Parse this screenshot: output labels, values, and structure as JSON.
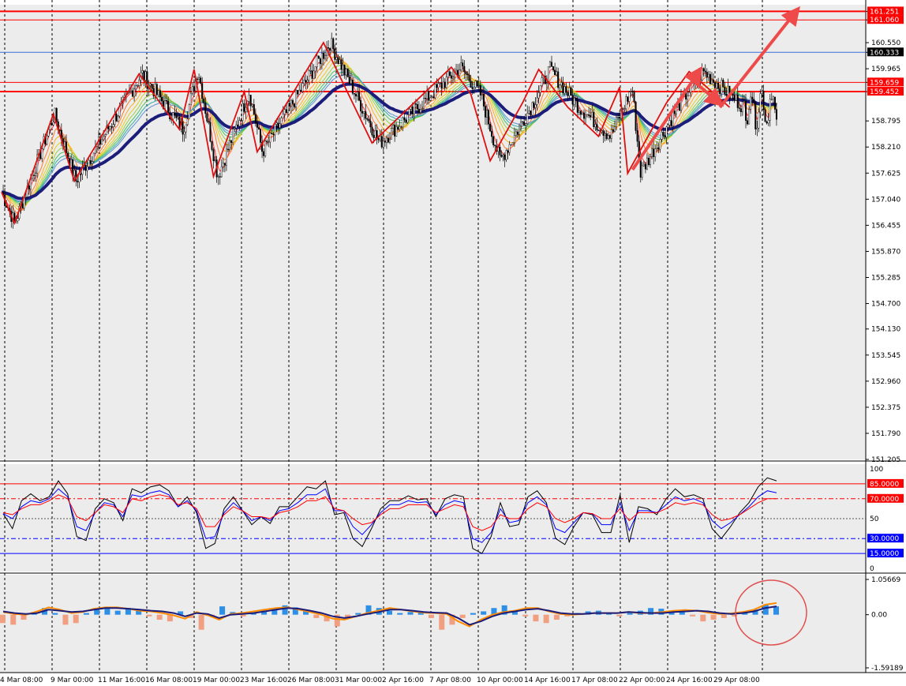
{
  "chart_data": [
    {
      "type": "candlestick",
      "ylim": [
        151.205,
        161.4
      ],
      "price_ticks": [
        "161.251",
        "161.060",
        "160.550",
        "160.333",
        "159.965",
        "159.659",
        "159.452",
        "158.795",
        "158.210",
        "157.625",
        "157.040",
        "156.455",
        "155.870",
        "155.285",
        "154.700",
        "154.130",
        "153.545",
        "152.960",
        "152.375",
        "151.790",
        "151.205"
      ],
      "tagged_levels": [
        {
          "label": "161.251",
          "value": 161.251,
          "color": "#ff0000"
        },
        {
          "label": "161.060",
          "value": 161.06,
          "color": "#ff0000"
        },
        {
          "label": "160.333",
          "value": 160.333,
          "color": "#000000"
        },
        {
          "label": "159.659",
          "value": 159.659,
          "color": "#ff0000"
        },
        {
          "label": "159.452",
          "value": 159.452,
          "color": "#ff0000"
        }
      ],
      "horizontal_lines": [
        161.251,
        161.06,
        159.659,
        159.452
      ],
      "current_price_line": 160.333,
      "zigzag": [
        {
          "bar": 0,
          "price": 157.2
        },
        {
          "bar": 8,
          "price": 156.5
        },
        {
          "bar": 32,
          "price": 158.95
        },
        {
          "bar": 45,
          "price": 157.45
        },
        {
          "bar": 85,
          "price": 159.85
        },
        {
          "bar": 110,
          "price": 158.6
        },
        {
          "bar": 119,
          "price": 159.95
        },
        {
          "bar": 131,
          "price": 157.55
        },
        {
          "bar": 150,
          "price": 159.45
        },
        {
          "bar": 158,
          "price": 158.1
        },
        {
          "bar": 199,
          "price": 160.55
        },
        {
          "bar": 229,
          "price": 158.3
        },
        {
          "bar": 278,
          "price": 160.0
        },
        {
          "bar": 290,
          "price": 159.4
        },
        {
          "bar": 302,
          "price": 157.9
        },
        {
          "bar": 322,
          "price": 159.2
        },
        {
          "bar": 332,
          "price": 159.95
        },
        {
          "bar": 350,
          "price": 159.1
        },
        {
          "bar": 369,
          "price": 158.45
        },
        {
          "bar": 382,
          "price": 159.55
        },
        {
          "bar": 387,
          "price": 157.62
        },
        {
          "bar": 411,
          "price": 159.2
        },
        {
          "bar": 425,
          "price": 159.9
        },
        {
          "bar": 450,
          "price": 159.1
        }
      ],
      "projection_arrows": [
        {
          "from_bar": 390,
          "from_price": 157.7,
          "to_bar": 430,
          "to_price": 159.85
        },
        {
          "from_bar": 424,
          "from_price": 159.8,
          "to_bar": 442,
          "to_price": 159.25
        },
        {
          "from_bar": 444,
          "from_price": 159.1,
          "to_bar": 490,
          "to_price": 161.2
        }
      ]
    },
    {
      "type": "line",
      "ylim": [
        0,
        100
      ],
      "y_ticks": [
        "100",
        "85.0000",
        "70.0000",
        "50",
        "30.0000",
        "15.0000",
        "0"
      ],
      "levels": [
        {
          "value": 85,
          "label": "85.0000",
          "color": "#ff0000"
        },
        {
          "value": 70,
          "label": "70.0000",
          "color": "#ff0000"
        },
        {
          "value": 30,
          "label": "30.0000",
          "color": "#0000ff"
        },
        {
          "value": 15,
          "label": "15.0000",
          "color": "#0000ff"
        }
      ],
      "series": [
        {
          "color": "#000000",
          "values": [
            55,
            40,
            68,
            75,
            68,
            72,
            88,
            75,
            32,
            28,
            60,
            70,
            66,
            48,
            80,
            76,
            82,
            84,
            78,
            62,
            72,
            56,
            20,
            25,
            60,
            72,
            58,
            44,
            52,
            45,
            62,
            62,
            72,
            82,
            80,
            88,
            54,
            56,
            30,
            22,
            40,
            60,
            68,
            68,
            73,
            69,
            70,
            52,
            70,
            74,
            72,
            20,
            15,
            32,
            66,
            42,
            44,
            72,
            78,
            66,
            30,
            24,
            42,
            56,
            54,
            36,
            36,
            74,
            26,
            62,
            60,
            54,
            70,
            80,
            72,
            74,
            70,
            40,
            30,
            42,
            56,
            66,
            82,
            91,
            88
          ]
        },
        {
          "color": "#0000ff",
          "values": [
            55,
            50,
            62,
            68,
            66,
            70,
            80,
            72,
            42,
            38,
            56,
            66,
            64,
            52,
            74,
            72,
            76,
            78,
            74,
            62,
            68,
            58,
            30,
            32,
            56,
            66,
            58,
            48,
            52,
            48,
            58,
            60,
            66,
            74,
            74,
            80,
            58,
            58,
            42,
            34,
            44,
            56,
            64,
            64,
            68,
            66,
            67,
            54,
            64,
            68,
            66,
            30,
            26,
            36,
            60,
            46,
            48,
            66,
            72,
            64,
            40,
            36,
            46,
            56,
            55,
            44,
            44,
            66,
            38,
            58,
            58,
            56,
            64,
            72,
            68,
            70,
            66,
            48,
            40,
            46,
            54,
            62,
            72,
            78,
            76
          ]
        },
        {
          "color": "#ff0000",
          "values": [
            56,
            54,
            60,
            64,
            64,
            68,
            74,
            70,
            52,
            48,
            56,
            64,
            62,
            56,
            70,
            68,
            72,
            74,
            72,
            64,
            66,
            60,
            42,
            42,
            54,
            62,
            58,
            52,
            52,
            50,
            56,
            58,
            62,
            68,
            68,
            72,
            60,
            58,
            50,
            44,
            46,
            54,
            60,
            60,
            64,
            64,
            64,
            56,
            60,
            64,
            62,
            42,
            38,
            42,
            54,
            50,
            50,
            60,
            66,
            62,
            50,
            46,
            50,
            56,
            55,
            50,
            50,
            60,
            48,
            56,
            56,
            56,
            60,
            66,
            64,
            66,
            64,
            54,
            48,
            50,
            54,
            60,
            66,
            70,
            70
          ]
        }
      ]
    },
    {
      "type": "bar",
      "ylim": [
        -1.59189,
        1.05669
      ],
      "y_ticks": [
        "1.05669",
        "0.00",
        "-1.59189"
      ],
      "series": [
        {
          "name": "histogram",
          "values": [
            -0.25,
            -0.3,
            -0.15,
            0.05,
            0.2,
            0.05,
            -0.3,
            -0.25,
            0.05,
            0.2,
            0.18,
            0.12,
            0.2,
            0.15,
            -0.05,
            -0.15,
            -0.2,
            0.1,
            -0.1,
            -0.45,
            -0.05,
            0.25,
            0.08,
            -0.05,
            0.05,
            0.12,
            0.2,
            0.28,
            0.22,
            0.15,
            -0.1,
            -0.2,
            -0.35,
            -0.1,
            0.05,
            0.28,
            0.2,
            0.12,
            0.05,
            0.08,
            0.1,
            -0.1,
            -0.45,
            -0.3,
            -0.1,
            0.05,
            0.1,
            0.2,
            0.28,
            0.12,
            -0.05,
            -0.2,
            -0.25,
            -0.15,
            -0.05,
            0.05,
            0.1,
            0.12,
            0.05,
            -0.05,
            0.05,
            0.12,
            0.2,
            0.18,
            0.1,
            0.08,
            -0.05,
            -0.2,
            -0.15,
            -0.1,
            -0.05,
            0.05,
            0.15,
            0.3,
            0.25
          ]
        },
        {
          "name": "signal",
          "values": [
            0.1,
            0.05,
            0.02,
            0.05,
            0.15,
            0.12,
            0.08,
            0.1,
            0.15,
            0.2,
            0.2,
            0.18,
            0.15,
            0.12,
            0.1,
            0.05,
            -0.05,
            0.05,
            0.02,
            -0.1,
            0.0,
            0.02,
            0.05,
            0.1,
            0.15,
            0.2,
            0.18,
            0.12,
            0.05,
            -0.05,
            -0.1,
            -0.05,
            0.02,
            0.08,
            0.15,
            0.15,
            0.12,
            0.08,
            0.06,
            0.05,
            -0.1,
            -0.3,
            -0.2,
            -0.05,
            0.05,
            0.1,
            0.15,
            0.18,
            0.12,
            0.05,
            0.02,
            0.02,
            0.05,
            0.05,
            0.05,
            0.08,
            0.06,
            0.05,
            0.05,
            0.08,
            0.1,
            0.12,
            0.1,
            0.05,
            0.02,
            0.05,
            0.1,
            0.2,
            0.25
          ]
        },
        {
          "name": "main",
          "values": [
            0.08,
            0.02,
            0.0,
            0.1,
            0.22,
            0.15,
            0.05,
            0.08,
            0.18,
            0.22,
            0.22,
            0.18,
            0.12,
            0.1,
            0.05,
            -0.02,
            -0.12,
            0.08,
            -0.02,
            -0.15,
            0.02,
            0.05,
            0.1,
            0.15,
            0.2,
            0.22,
            0.15,
            0.08,
            0.0,
            -0.12,
            -0.15,
            -0.05,
            0.05,
            0.12,
            0.2,
            0.15,
            0.1,
            0.06,
            0.05,
            0.02,
            -0.2,
            -0.35,
            -0.15,
            0.0,
            0.08,
            0.12,
            0.2,
            0.2,
            0.1,
            0.02,
            0.0,
            0.02,
            0.05,
            0.05,
            0.05,
            0.08,
            0.05,
            0.05,
            0.08,
            0.12,
            0.14,
            0.12,
            0.06,
            0.02,
            0.04,
            0.08,
            0.15,
            0.3,
            0.35
          ]
        }
      ]
    }
  ],
  "time_axis": [
    "4 Mar 08:00",
    "9 Mar 00:00",
    "11 Mar 16:00",
    "16 Mar 08:00",
    "19 Mar 00:00",
    "23 Mar 16:00",
    "26 Mar 08:00",
    "31 Mar 00:00",
    "2 Apr 16:00",
    "7 Apr 08:00",
    "10 Apr 00:00",
    "14 Apr 16:00",
    "17 Apr 08:00",
    "22 Apr 00:00",
    "24 Apr 16:00",
    "29 Apr 08:00"
  ],
  "colors": {
    "level_red": "#ff0000",
    "ma_thick": "#1c1c7a",
    "bull_bar": "#2e8fe6",
    "bear_bar": "#f0a080",
    "signal_line": "#ff8c00",
    "arrow": "#ef4a4a"
  }
}
